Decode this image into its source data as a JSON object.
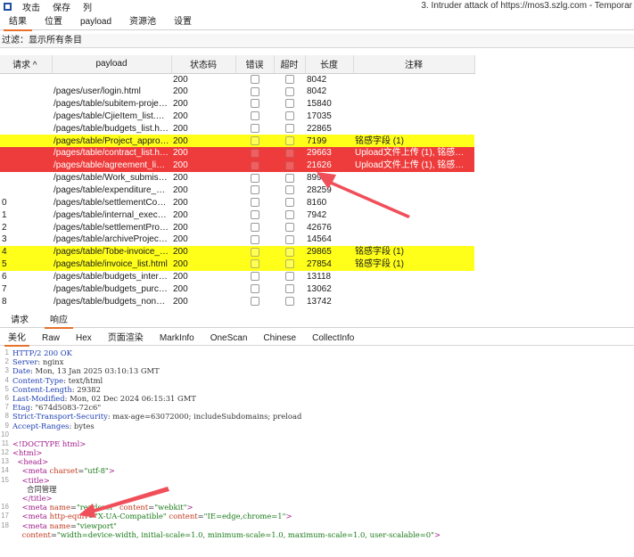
{
  "menu": {
    "items": [
      "攻击",
      "保存",
      "列"
    ],
    "window_title": "3. Intruder attack of https://mos3.szlg.com - Temporar"
  },
  "top_tabs": [
    "结果",
    "位置",
    "payload",
    "资源池",
    "设置"
  ],
  "filter_text": "过滤：显示所有条目",
  "table": {
    "headers": [
      "请求 ^",
      "payload",
      "状态码",
      "错误",
      "超时",
      "长度",
      "注释"
    ],
    "rows": [
      {
        "req": "",
        "payload": "",
        "status": "200",
        "length": "8042",
        "note": "",
        "hl": ""
      },
      {
        "req": "",
        "payload": "/pages/user/login.html",
        "status": "200",
        "length": "8042",
        "note": "",
        "hl": ""
      },
      {
        "req": "",
        "payload": "/pages/table/subitem-projec...",
        "status": "200",
        "length": "15840",
        "note": "",
        "hl": ""
      },
      {
        "req": "",
        "payload": "/pages/table/CjieItem_list.html",
        "status": "200",
        "length": "17035",
        "note": "",
        "hl": ""
      },
      {
        "req": "",
        "payload": "/pages/table/budgets_list.html",
        "status": "200",
        "length": "22865",
        "note": "",
        "hl": ""
      },
      {
        "req": "",
        "payload": "/pages/table/Project_approv...",
        "status": "200",
        "length": "7199",
        "note": "铭感字段 (1)",
        "hl": "yellow"
      },
      {
        "req": "",
        "payload": "/pages/table/contract_list.ht...",
        "status": "200",
        "length": "29663",
        "note": "Upload文件上传 (1), 铭感字段 ...",
        "hl": "red"
      },
      {
        "req": "",
        "payload": "/pages/table/agreement_list....",
        "status": "200",
        "length": "21626",
        "note": "Upload文件上传 (1), 铭感字段 ...",
        "hl": "red"
      },
      {
        "req": "",
        "payload": "/pages/table/Work_submissi...",
        "status": "200",
        "length": "8992",
        "note": "",
        "hl": ""
      },
      {
        "req": "",
        "payload": "/pages/table/expenditure_pr...",
        "status": "200",
        "length": "28259",
        "note": "",
        "hl": ""
      },
      {
        "req": "0",
        "payload": "/pages/table/settlementCost...",
        "status": "200",
        "length": "8160",
        "note": "",
        "hl": ""
      },
      {
        "req": "1",
        "payload": "/pages/table/internal_executi...",
        "status": "200",
        "length": "7942",
        "note": "",
        "hl": ""
      },
      {
        "req": "2",
        "payload": "/pages/table/settlementProje...",
        "status": "200",
        "length": "42676",
        "note": "",
        "hl": ""
      },
      {
        "req": "3",
        "payload": "/pages/table/archiveProject_l...",
        "status": "200",
        "length": "14564",
        "note": "",
        "hl": ""
      },
      {
        "req": "4",
        "payload": "/pages/table/Tobe-invoice_li...",
        "status": "200",
        "length": "29865",
        "note": "铭感字段 (1)",
        "hl": "yellow"
      },
      {
        "req": "5",
        "payload": "/pages/table/invoice_list.html",
        "status": "200",
        "length": "27854",
        "note": "铭感字段 (1)",
        "hl": "yellow"
      },
      {
        "req": "6",
        "payload": "/pages/table/budgets_intern...",
        "status": "200",
        "length": "13118",
        "note": "",
        "hl": ""
      },
      {
        "req": "7",
        "payload": "/pages/table/budgets_purch...",
        "status": "200",
        "length": "13062",
        "note": "",
        "hl": ""
      },
      {
        "req": "8",
        "payload": "/pages/table/budgets_nonca...",
        "status": "200",
        "length": "13742",
        "note": "",
        "hl": ""
      }
    ]
  },
  "bottom_tabs": [
    "请求",
    "响应"
  ],
  "view_tabs": [
    "美化",
    "Raw",
    "Hex",
    "页面渲染",
    "MarkInfo",
    "OneScan",
    "Chinese",
    "CollectInfo"
  ],
  "response_lines": [
    {
      "n": "1",
      "html": "<span class='hk'>HTTP/2 200 OK</span>"
    },
    {
      "n": "2",
      "html": "<span class='hk'>Server</span><span class='hv'>: nginx</span>"
    },
    {
      "n": "3",
      "html": "<span class='hk'>Date</span><span class='hv'>: Mon, 13 Jan 2025 03:10:13 GMT</span>"
    },
    {
      "n": "4",
      "html": "<span class='hk'>Content-Type</span><span class='hv'>: text/html</span>"
    },
    {
      "n": "5",
      "html": "<span class='hk'>Content-Length</span><span class='hv'>: 29382</span>"
    },
    {
      "n": "6",
      "html": "<span class='hk'>Last-Modified</span><span class='hv'>: Mon, 02 Dec 2024 06:15:31 GMT</span>"
    },
    {
      "n": "7",
      "html": "<span class='hk'>Etag</span><span class='hv'>: \"674d5083-72c6\"</span>"
    },
    {
      "n": "8",
      "html": "<span class='hk'>Strict-Transport-Security</span><span class='hv'>: max-age=63072000; includeSubdomains; preload</span>"
    },
    {
      "n": "9",
      "html": "<span class='hk'>Accept-Ranges</span><span class='hv'>: bytes</span>"
    },
    {
      "n": "10",
      "html": ""
    },
    {
      "n": "11",
      "html": "<span class='tag'>&lt;!DOCTYPE html&gt;</span>"
    },
    {
      "n": "12",
      "html": "<span class='tag'>&lt;html&gt;</span>"
    },
    {
      "n": "13",
      "html": "  <span class='tag'>&lt;head&gt;</span>"
    },
    {
      "n": "14",
      "html": "    <span class='tag'>&lt;meta</span> <span class='attr'>charset</span>=<span class='aval'>\"utf-8\"</span><span class='tag'>&gt;</span>"
    },
    {
      "n": "15",
      "html": "    <span class='tag'>&lt;title&gt;</span>"
    },
    {
      "n": "",
      "html": "      合同管理"
    },
    {
      "n": "",
      "html": "    <span class='tag'>&lt;/title&gt;</span>"
    },
    {
      "n": "16",
      "html": "    <span class='tag'>&lt;meta</span> <span class='attr'>name</span>=<span class='aval'>\"renderer\"</span> <span class='attr'>content</span>=<span class='aval'>\"webkit\"</span><span class='tag'>&gt;</span>"
    },
    {
      "n": "17",
      "html": "    <span class='tag'>&lt;meta</span> <span class='attr'>http-equiv</span>=<span class='aval'>\"X-UA-Compatible\"</span> <span class='attr'>content</span>=<span class='aval'>\"IE=edge,chrome=1\"</span><span class='tag'>&gt;</span>"
    },
    {
      "n": "18",
      "html": "    <span class='tag'>&lt;meta</span> <span class='attr'>name</span>=<span class='aval'>\"viewport\"</span>"
    },
    {
      "n": "",
      "html": "    <span class='attr'>content</span>=<span class='aval'>\"width=device-width, initial-scale=1.0, minimum-scale=1.0, maximum-scale=1.0, user-scalable=0\"</span><span class='tag'>&gt;</span>"
    }
  ],
  "colors": {
    "accent": "#e8712b",
    "highlight_yellow": "#ffff1a",
    "highlight_red": "#ee3b3b",
    "annotation_arrow": "#f04f5a"
  }
}
